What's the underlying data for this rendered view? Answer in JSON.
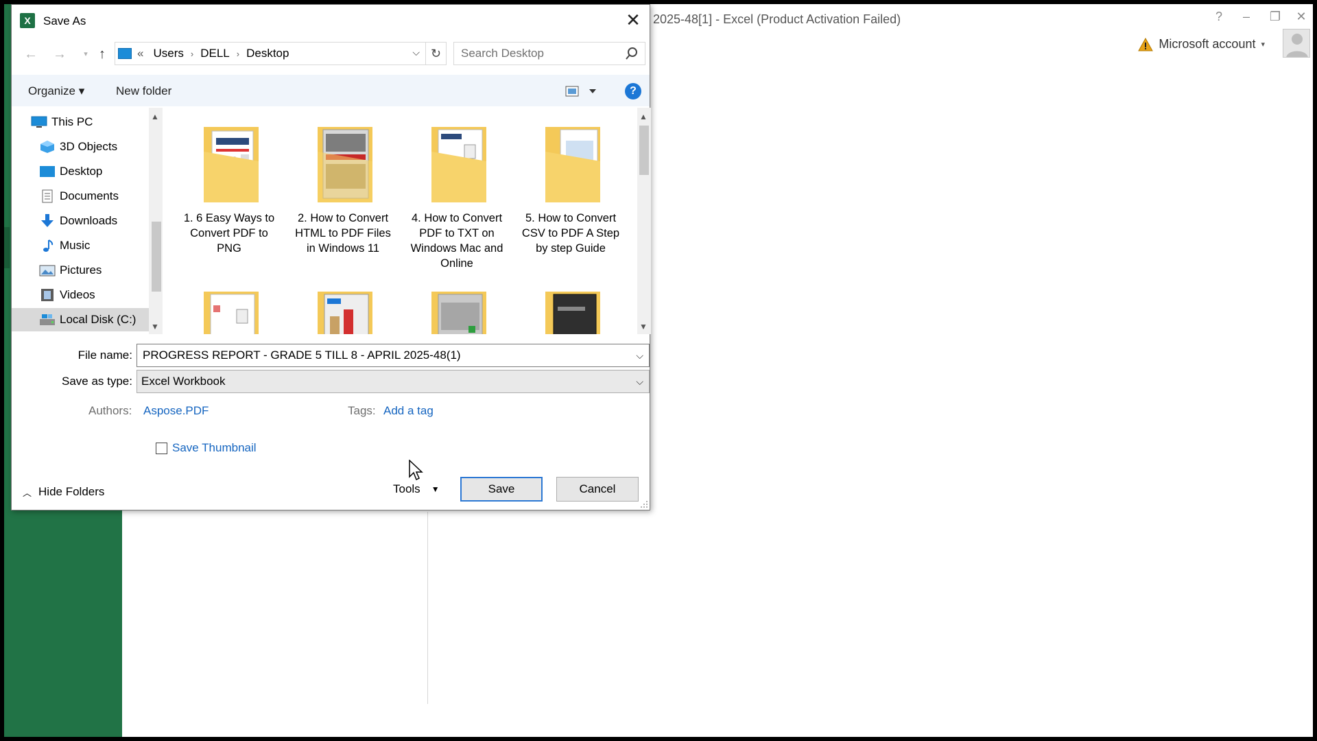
{
  "excel": {
    "title": "2025-48[1] - Excel (Product Activation Failed)",
    "controls": {
      "help": "?",
      "minimize": "–",
      "restore": "❐",
      "close": "✕"
    },
    "account_label": "Microsoft account",
    "accent_color": "#217346"
  },
  "dialog": {
    "title": "Save As",
    "close_glyph": "✕",
    "address": {
      "overflow": "«",
      "crumbs": [
        "Users",
        "DELL",
        "Desktop"
      ]
    },
    "search_placeholder": "Search Desktop",
    "toolbar": {
      "organize": "Organize ▾",
      "new_folder": "New folder",
      "help": "?"
    },
    "nav": [
      {
        "label": "This PC",
        "icon": "this-pc-icon"
      },
      {
        "label": "3D Objects",
        "icon": "3d-objects-icon"
      },
      {
        "label": "Desktop",
        "icon": "desktop-icon"
      },
      {
        "label": "Documents",
        "icon": "documents-icon"
      },
      {
        "label": "Downloads",
        "icon": "downloads-icon"
      },
      {
        "label": "Music",
        "icon": "music-icon"
      },
      {
        "label": "Pictures",
        "icon": "pictures-icon"
      },
      {
        "label": "Videos",
        "icon": "videos-icon"
      },
      {
        "label": "Local Disk (C:)",
        "icon": "local-disk-icon",
        "selected": true
      }
    ],
    "folders": [
      {
        "label": "1. 6 Easy Ways to Convert PDF to PNG"
      },
      {
        "label": "2. How to Convert HTML to PDF Files in Windows 11"
      },
      {
        "label": "4. How to Convert PDF to TXT on Windows Mac and Online"
      },
      {
        "label": "5. How to Convert CSV to PDF A Step by step Guide"
      },
      {
        "label": ""
      },
      {
        "label": ""
      },
      {
        "label": ""
      },
      {
        "label": ""
      }
    ],
    "form": {
      "file_name_label": "File name:",
      "file_name_value": "PROGRESS REPORT - GRADE 5 TILL 8 - APRIL 2025-48(1)",
      "save_type_label": "Save as type:",
      "save_type_value": "Excel Workbook",
      "authors_label": "Authors:",
      "authors_value": "Aspose.PDF",
      "tags_label": "Tags:",
      "tags_value": "Add a tag",
      "thumbnail_label": "Save Thumbnail",
      "thumbnail_checked": false
    },
    "footer": {
      "hide_folders": "Hide Folders",
      "tools": "Tools",
      "save": "Save",
      "cancel": "Cancel"
    }
  }
}
